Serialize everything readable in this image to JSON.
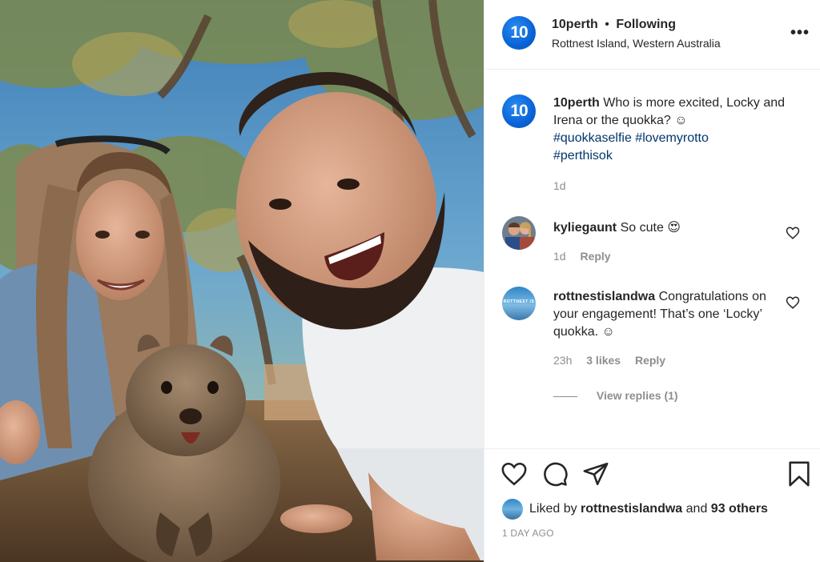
{
  "post": {
    "author": "10perth",
    "follow_separator": "•",
    "follow_status": "Following",
    "location": "Rottnest Island, Western Australia",
    "more_label": "•••",
    "avatar_text": "10"
  },
  "caption": {
    "username": "10perth",
    "text": "Who is more excited, Locky and Irena or the quokka? ☺",
    "hashtags": [
      "#quokkaselfie",
      "#lovemyrotto",
      "#perthisok"
    ],
    "time": "1d"
  },
  "comments": [
    {
      "username": "kyliegaunt",
      "text": "So cute 😍",
      "time": "1d",
      "reply_label": "Reply"
    },
    {
      "username": "rottnestislandwa",
      "text": "Congratulations on your engagement! That’s one ‘Locky’ quokka. ☺",
      "time": "23h",
      "likes": "3 likes",
      "reply_label": "Reply",
      "avatar_text": "ROTTNEST IS"
    }
  ],
  "view_replies": "View replies (1)",
  "likes": {
    "prefix": "Liked by",
    "user": "rottnestislandwa",
    "and": "and",
    "others": "93 others"
  },
  "posted": "1 DAY AGO",
  "icons": [
    "more-icon",
    "heart-icon",
    "comment-icon",
    "share-icon",
    "bookmark-icon"
  ],
  "colors": {
    "hashtag": "#00376b",
    "avatar_blue": "#0a63d6",
    "muted": "#8e8e8e"
  }
}
